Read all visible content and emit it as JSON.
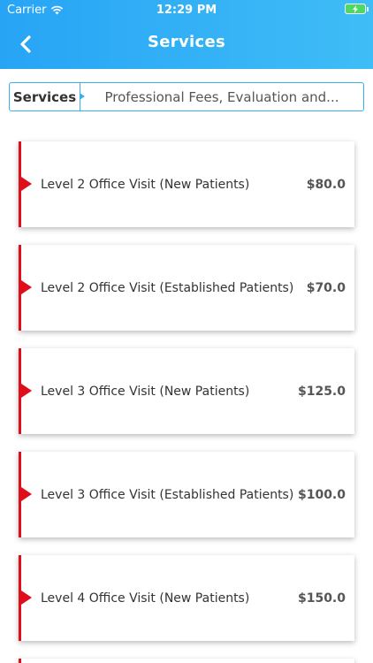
{
  "status_bar": {
    "carrier": "Carrier",
    "time": "12:29 PM"
  },
  "header": {
    "title": "Services"
  },
  "selector": {
    "label": "Services",
    "value": "Professional Fees, Evaluation and..."
  },
  "services": [
    {
      "name": "Level 2 Office Visit (New Patients)",
      "price": "$80.0"
    },
    {
      "name": "Level 2 Office Visit (Established Patients)",
      "price": "$70.0"
    },
    {
      "name": "Level 3 Office Visit (New Patients)",
      "price": "$125.0"
    },
    {
      "name": "Level 3 Office Visit (Established Patients)",
      "price": "$100.0"
    },
    {
      "name": "Level 4 Office Visit (New Patients)",
      "price": "$150.0"
    }
  ],
  "colors": {
    "header_start": "#27a4f5",
    "header_end": "#3fbdf6",
    "accent_red": "#e00e1b",
    "selector_border": "#3aaff0"
  }
}
